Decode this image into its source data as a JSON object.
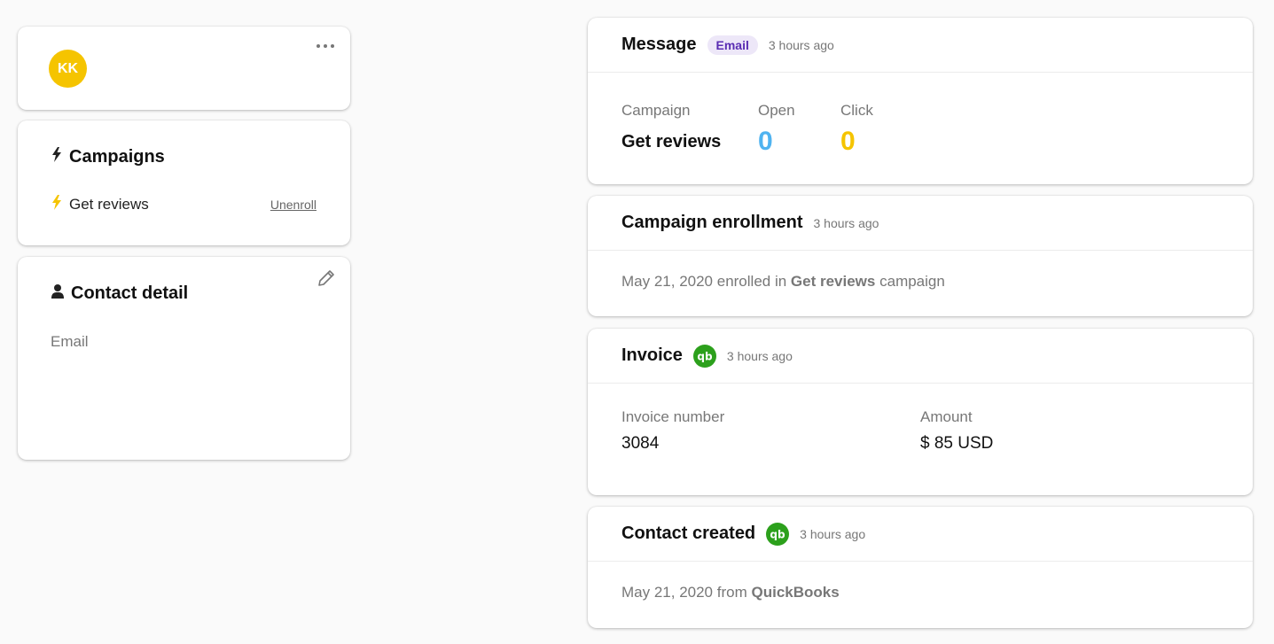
{
  "profile": {
    "initials": "KK",
    "avatar_color": "#f5c400"
  },
  "campaigns_card": {
    "title": "Campaigns",
    "items": [
      {
        "name": "Get reviews",
        "action": "Unenroll"
      }
    ]
  },
  "contact_card": {
    "title": "Contact detail",
    "email_label": "Email"
  },
  "timeline": {
    "message": {
      "title": "Message",
      "badge": "Email",
      "time": "3 hours ago",
      "campaign_label": "Campaign",
      "campaign_value": "Get reviews",
      "open_label": "Open",
      "open_value": "0",
      "click_label": "Click",
      "click_value": "0",
      "open_color": "#4fb3f0",
      "click_color": "#f5c400"
    },
    "enrollment": {
      "title": "Campaign enrollment",
      "time": "3 hours ago",
      "date": "May 21, 2020 enrolled in",
      "campaign": "Get reviews",
      "suffix": "campaign"
    },
    "invoice": {
      "title": "Invoice",
      "time": "3 hours ago",
      "number_label": "Invoice number",
      "number_value": "3084",
      "amount_label": "Amount",
      "amount_value": "$ 85 USD"
    },
    "contact_created": {
      "title": "Contact created",
      "time": "3 hours ago",
      "date": "May 21, 2020 from",
      "source": "QuickBooks"
    }
  },
  "colors": {
    "quickbooks_green": "#2ca01c",
    "accent_yellow": "#f5c400"
  },
  "icons": [
    "more-icon",
    "bolt-icon",
    "person-icon",
    "pencil-icon",
    "quickbooks-icon"
  ]
}
